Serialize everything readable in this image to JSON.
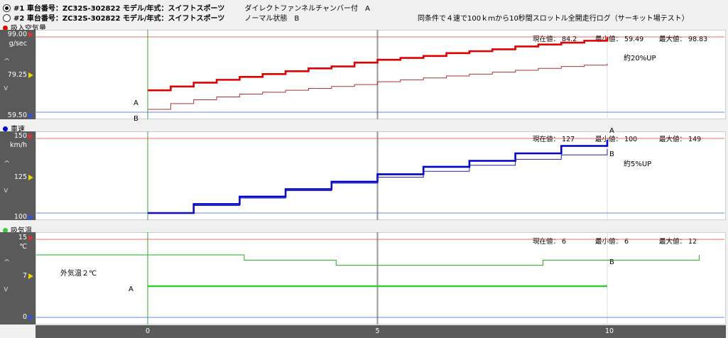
{
  "header": {
    "runs": [
      {
        "selected": true,
        "vehicle": "#1 車台番号：ZC32S-302822  モデル/年式：スイフトスポーツ",
        "note": "ダイレクトファンネルチャンバー付",
        "compare_label": "A"
      },
      {
        "selected": false,
        "vehicle": "#2 車台番号：ZC32S-302822  モデル/年式：スイフトスポーツ",
        "note": "ノーマル状態",
        "compare_label": "B"
      }
    ],
    "condition": "同条件で４速で100ｋｍから10秒間スロットル全開走行ログ（サーキット場テスト）"
  },
  "stats_labels": {
    "current": "現在値：",
    "min": "最小値：",
    "max": "最大値："
  },
  "nav_glyphs": {
    "up": "^",
    "down": "v"
  },
  "colors": {
    "series_a_airflow": "#e00000",
    "series_b_airflow": "#b03030",
    "series_a_speed": "#0000cc",
    "series_b_speed": "#2020aa",
    "series_a_temp": "#33cc33",
    "series_b_temp": "#22aa22",
    "marker_red": "#e03030",
    "marker_yellow": "#e8d800",
    "marker_blue": "#3050e0"
  },
  "chart_data": [
    {
      "type": "line",
      "title": "吸入空気量",
      "title_dot_color": "#e00000",
      "unit": "g/sec",
      "ylim": [
        59.5,
        99.0
      ],
      "yticks": [
        "99.00",
        "79.25",
        "59.50"
      ],
      "xlim": [
        0,
        12
      ],
      "xticks": [
        "0",
        "5",
        "10"
      ],
      "stats": {
        "current": "84.2",
        "min": "59.49",
        "max": "98.83"
      },
      "annotation": "約20%UP",
      "series": [
        {
          "name": "A",
          "x": [
            0,
            0.5,
            1,
            1.5,
            2,
            2.5,
            3,
            3.5,
            4,
            4.5,
            5,
            5.5,
            6,
            6.5,
            7,
            7.5,
            8,
            8.5,
            9,
            9.5,
            10
          ],
          "y": [
            71,
            73,
            75,
            76.5,
            78,
            79.5,
            81,
            82.5,
            83.5,
            85.5,
            87,
            88,
            89,
            90.5,
            91.5,
            92.5,
            94,
            95,
            96,
            97,
            98.8
          ]
        },
        {
          "name": "B",
          "x": [
            0,
            0.5,
            1,
            1.5,
            2,
            2.5,
            3,
            3.5,
            4,
            4.5,
            5,
            5.5,
            6,
            6.5,
            7,
            7.5,
            8,
            8.5,
            9,
            9.5,
            10
          ],
          "y": [
            61,
            64,
            66,
            67.5,
            69,
            70,
            71,
            72,
            73,
            74,
            75.5,
            76.5,
            77.5,
            78.5,
            79.5,
            80.5,
            81.5,
            82.5,
            83.5,
            84.2,
            85
          ]
        }
      ]
    },
    {
      "type": "line",
      "title": "車速",
      "title_dot_color": "#0000cc",
      "unit": "km/h",
      "ylim": [
        100,
        150
      ],
      "yticks": [
        "150",
        "125",
        "100"
      ],
      "xlim": [
        0,
        12
      ],
      "xticks": [
        "0",
        "5",
        "10"
      ],
      "stats": {
        "current": "127",
        "min": "100",
        "max": "149"
      },
      "annotation": "約5%UP",
      "series": [
        {
          "name": "A",
          "x": [
            0,
            1,
            2,
            3,
            4,
            5,
            6,
            7,
            8,
            9,
            10
          ],
          "y": [
            100,
            106,
            111,
            116,
            121,
            126,
            131,
            135,
            140,
            145,
            149
          ]
        },
        {
          "name": "B",
          "x": [
            0,
            1,
            2,
            3,
            4,
            5,
            6,
            7,
            8,
            9,
            10
          ],
          "y": [
            100,
            105,
            110,
            115,
            120,
            124,
            128,
            132,
            136,
            139,
            143
          ]
        }
      ]
    },
    {
      "type": "line",
      "title": "吸気温",
      "title_dot_color": "#33cc33",
      "unit": "℃",
      "ylim": [
        0,
        15
      ],
      "yticks": [
        "15",
        "7",
        "0"
      ],
      "xlim": [
        0,
        12
      ],
      "xticks": [
        "0",
        "5",
        "10"
      ],
      "stats": {
        "current": "6",
        "min": "6",
        "max": "12"
      },
      "annotation": "外気温２℃",
      "series": [
        {
          "name": "A",
          "x": [
            0,
            10
          ],
          "y": [
            6,
            6
          ]
        },
        {
          "name": "B",
          "x": [
            -2.5,
            2.1,
            2.1,
            4.1,
            4.1,
            8.6,
            8.6,
            10,
            12
          ],
          "y": [
            12,
            12,
            11,
            11,
            10,
            10,
            11,
            11,
            12
          ]
        }
      ]
    }
  ]
}
